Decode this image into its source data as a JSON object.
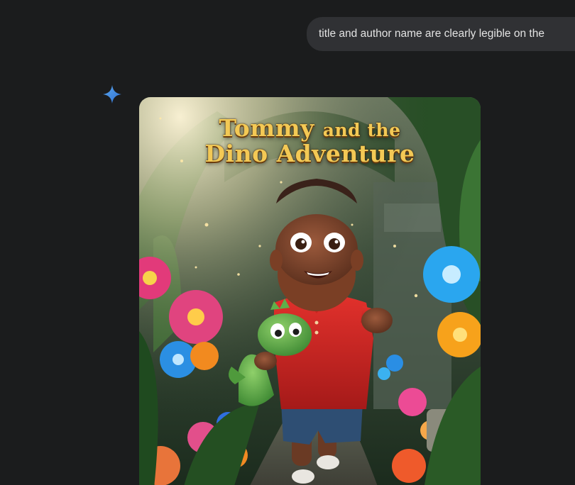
{
  "conversation": {
    "user_message_visible_text": "title and author name are clearly legible on the"
  },
  "response": {
    "model_icon": "gemini-sparkle-icon",
    "image": {
      "description_title_line1_big": "Tommy",
      "description_title_line1_small": "and the",
      "description_title_line2": "Dino Adventure"
    }
  },
  "colors": {
    "background": "#1b1c1d",
    "bubble": "#303134",
    "sparkle": "#4a90e2",
    "title_gold": "#f3c955"
  }
}
